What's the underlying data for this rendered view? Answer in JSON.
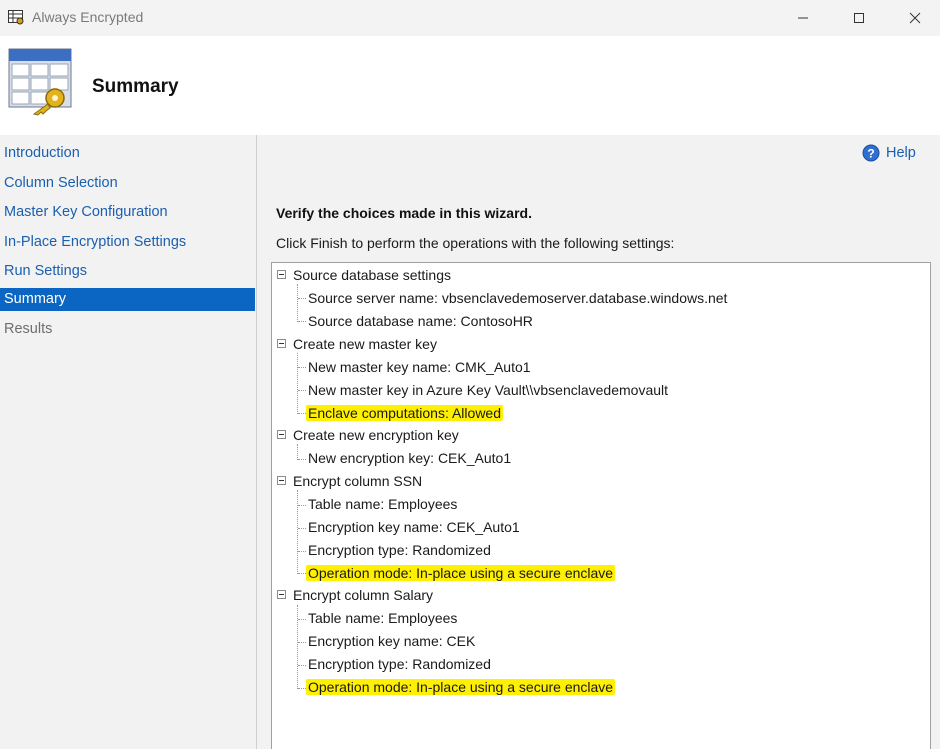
{
  "window": {
    "title": "Always Encrypted"
  },
  "header": {
    "title": "Summary"
  },
  "sidebar": {
    "items": [
      {
        "label": "Introduction",
        "state": "link"
      },
      {
        "label": "Column Selection",
        "state": "link"
      },
      {
        "label": "Master Key Configuration",
        "state": "link"
      },
      {
        "label": "In-Place Encryption Settings",
        "state": "link"
      },
      {
        "label": "Run Settings",
        "state": "link"
      },
      {
        "label": "Summary",
        "state": "active"
      },
      {
        "label": "Results",
        "state": "disabled"
      }
    ]
  },
  "help": {
    "label": "Help",
    "icon": "help-icon"
  },
  "main": {
    "heading": "Verify the choices made in this wizard.",
    "instructions": "Click Finish to perform the operations with the following settings:"
  },
  "tree": [
    {
      "label": "Source database settings",
      "children": [
        {
          "label": "Source server name: vbsenclavedemoserver.database.windows.net",
          "highlight": false
        },
        {
          "label": "Source database name: ContosoHR",
          "highlight": false
        }
      ]
    },
    {
      "label": "Create new master key",
      "children": [
        {
          "label": "New master key name: CMK_Auto1",
          "highlight": false
        },
        {
          "label": "New master key in Azure Key Vault\\\\vbsenclavedemovault",
          "highlight": false
        },
        {
          "label": "Enclave computations: Allowed",
          "highlight": true
        }
      ]
    },
    {
      "label": "Create new encryption key",
      "children": [
        {
          "label": "New encryption key: CEK_Auto1",
          "highlight": false
        }
      ]
    },
    {
      "label": "Encrypt column SSN",
      "children": [
        {
          "label": "Table name: Employees",
          "highlight": false
        },
        {
          "label": "Encryption key name: CEK_Auto1",
          "highlight": false
        },
        {
          "label": "Encryption type: Randomized",
          "highlight": false
        },
        {
          "label": "Operation mode: In-place using a secure enclave",
          "highlight": true
        }
      ]
    },
    {
      "label": "Encrypt column Salary",
      "children": [
        {
          "label": "Table name: Employees",
          "highlight": false
        },
        {
          "label": "Encryption key name: CEK",
          "highlight": false
        },
        {
          "label": "Encryption type: Randomized",
          "highlight": false
        },
        {
          "label": "Operation mode: In-place using a secure enclave",
          "highlight": true
        }
      ]
    }
  ],
  "colors": {
    "accent": "#0a66c2",
    "link": "#1a5fb0",
    "highlight": "#ffef00"
  }
}
